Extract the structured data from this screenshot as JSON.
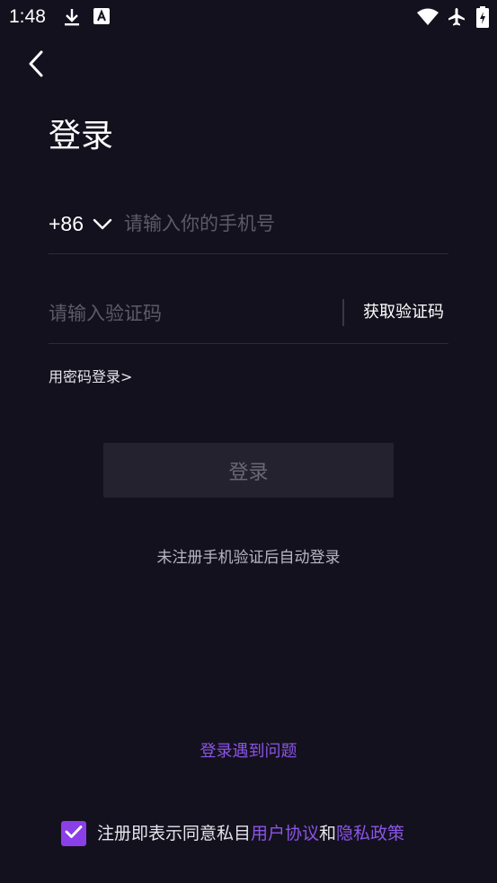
{
  "status_bar": {
    "time": "1:48",
    "icons": [
      "download-icon",
      "a-badge-icon",
      "wifi-icon",
      "airplane-mode-icon",
      "battery-charging-icon"
    ]
  },
  "header": {
    "back_icon": "back-arrow-icon",
    "title": "登录"
  },
  "phone": {
    "country_code": "+86",
    "placeholder": "请输入你的手机号",
    "value": ""
  },
  "code": {
    "placeholder": "请输入验证码",
    "value": "",
    "get_code_label": "获取验证码"
  },
  "password_login_label": "用密码登录>",
  "login_button_label": "登录",
  "auto_login_note": "未注册手机验证后自动登录",
  "trouble_link_label": "登录遇到问题",
  "agreement": {
    "checked": true,
    "prefix": "注册即表示同意私目",
    "user_agreement": "用户协议",
    "conjunction": "和",
    "privacy_policy": "隐私政策"
  },
  "colors": {
    "background": "#14111e",
    "accent": "#8b3fe8",
    "link": "#8a55e6",
    "button_disabled": "#24222f"
  }
}
